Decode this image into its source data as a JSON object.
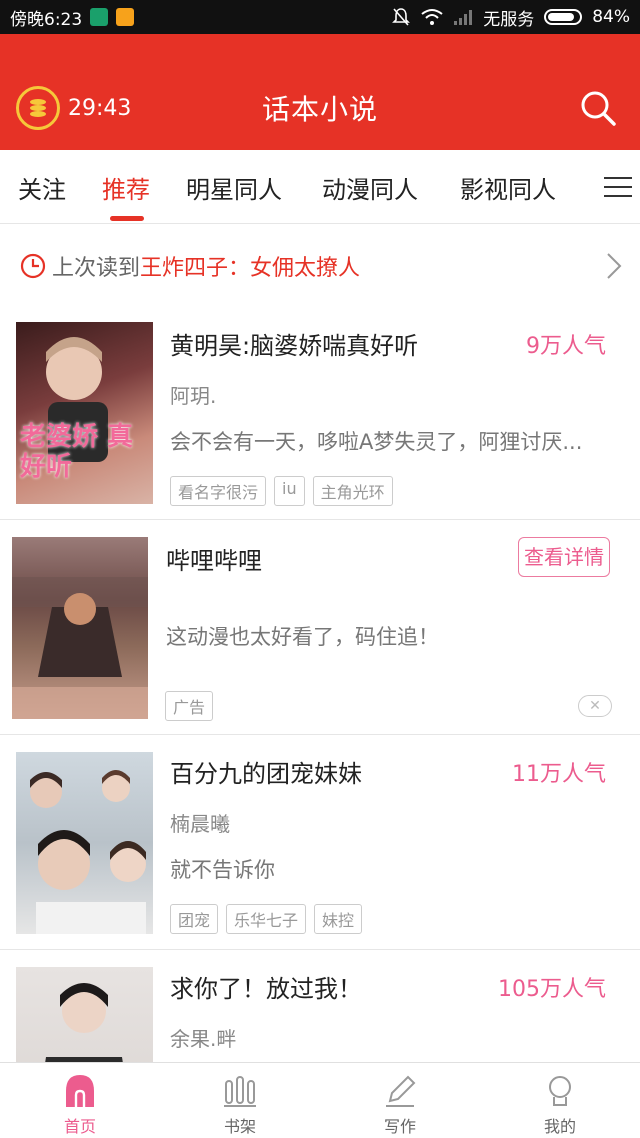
{
  "status_bar": {
    "time": "傍晚6:23",
    "carrier": "无服务",
    "battery": "84%"
  },
  "header": {
    "timer": "29:43",
    "title": "话本小说"
  },
  "tabs": [
    {
      "label": "关注"
    },
    {
      "label": "推荐"
    },
    {
      "label": "明星同人"
    },
    {
      "label": "动漫同人"
    },
    {
      "label": "影视同人"
    }
  ],
  "active_tab": "推荐",
  "last_read": {
    "label": "上次读到",
    "title": "王炸四子：女佣太撩人"
  },
  "books": [
    {
      "title": "黄明昊:脑婆娇喘真好听",
      "popularity": "9万人气",
      "author": "阿玥.",
      "description": "会不会有一天，哆啦A梦失灵了，阿狸讨厌...",
      "tags": [
        "看名字很污",
        "iu",
        "主角光环"
      ],
      "cover_text": "老婆娇 真好听"
    },
    {
      "title": "百分九的团宠妹妹",
      "popularity": "11万人气",
      "author": "楠晨曦",
      "description": "就不告诉你",
      "tags": [
        "团宠",
        "乐华七子",
        "妹控"
      ]
    },
    {
      "title": "求你了！放过我！",
      "popularity": "105万人气",
      "author": "余果.畔",
      "description": "",
      "tags": []
    }
  ],
  "ad": {
    "title": "哔哩哔哩",
    "button": "查看详情",
    "description": "这动漫也太好看了，码住追！",
    "badge": "广告"
  },
  "bottom_nav": [
    {
      "label": "首页",
      "icon": "home-icon"
    },
    {
      "label": "书架",
      "icon": "bookshelf-icon"
    },
    {
      "label": "写作",
      "icon": "pen-icon"
    },
    {
      "label": "我的",
      "icon": "profile-icon"
    }
  ],
  "colors": {
    "brand_red": "#e63226",
    "accent_pink": "#ec5c8e"
  }
}
